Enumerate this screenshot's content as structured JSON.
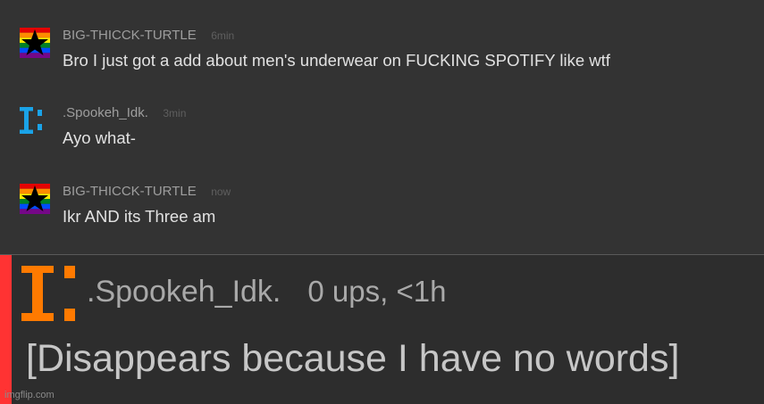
{
  "messages": [
    {
      "username": "BIG-THICCK-TURTLE",
      "time": "6min",
      "text": "Bro I just got a add about men's underwear on FUCKING SPOTIFY like wtf",
      "avatar": "rainbow-star-icon"
    },
    {
      "username": ".Spookeh_Idk.",
      "time": "3min",
      "text": "Ayo what-",
      "avatar": "blue-i-logo-icon"
    },
    {
      "username": "BIG-THICCK-TURTLE",
      "time": "now",
      "text": "Ikr AND its Three am",
      "avatar": "rainbow-star-icon"
    }
  ],
  "comment": {
    "username": ".Spookeh_Idk.",
    "stats": "0 ups, <1h",
    "text": "[Disappears because I have no words]",
    "avatar": "orange-i-logo-icon",
    "accent_color": "#ff3333"
  },
  "watermark": "imgflip.com",
  "colors": {
    "blue_logo": "#1aa3e8",
    "orange_logo": "#ff7a00"
  }
}
